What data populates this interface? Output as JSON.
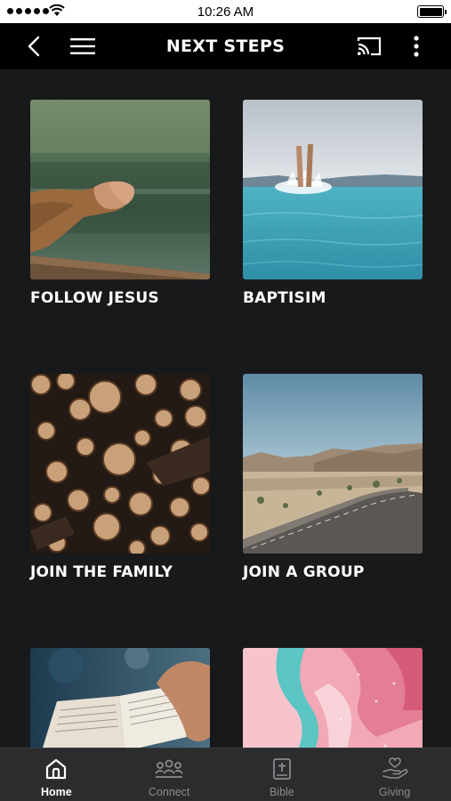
{
  "status_bar": {
    "time": "10:26 AM"
  },
  "app_bar": {
    "title": "NEXT STEPS",
    "back_icon": "chevron-left-icon",
    "menu_icon": "hamburger-icon",
    "cast_icon": "cast-icon",
    "more_icon": "more-vertical-icon"
  },
  "cards": [
    {
      "label": "FOLLOW JESUS",
      "image": "hands-clasped-over-lake"
    },
    {
      "label": "BAPTISIM",
      "image": "legs-diving-into-sea"
    },
    {
      "label": "JOIN THE FAMILY",
      "image": "stacked-log-ends"
    },
    {
      "label": "JOIN A GROUP",
      "image": "desert-road"
    },
    {
      "label": "",
      "image": "open-bible-in-hands"
    },
    {
      "label": "",
      "image": "pink-teal-marble-paint"
    }
  ],
  "tab_bar": {
    "items": [
      {
        "label": "Home",
        "icon": "home-icon",
        "active": true
      },
      {
        "label": "Connect",
        "icon": "people-icon",
        "active": false
      },
      {
        "label": "Bible",
        "icon": "bible-icon",
        "active": false
      },
      {
        "label": "Giving",
        "icon": "giving-hand-heart-icon",
        "active": false
      }
    ]
  },
  "colors": {
    "background": "#18191b",
    "app_bar": "#000000",
    "tab_bar": "#2b2c2e",
    "tab_inactive": "#8a8b8d",
    "tab_active": "#ffffff"
  }
}
